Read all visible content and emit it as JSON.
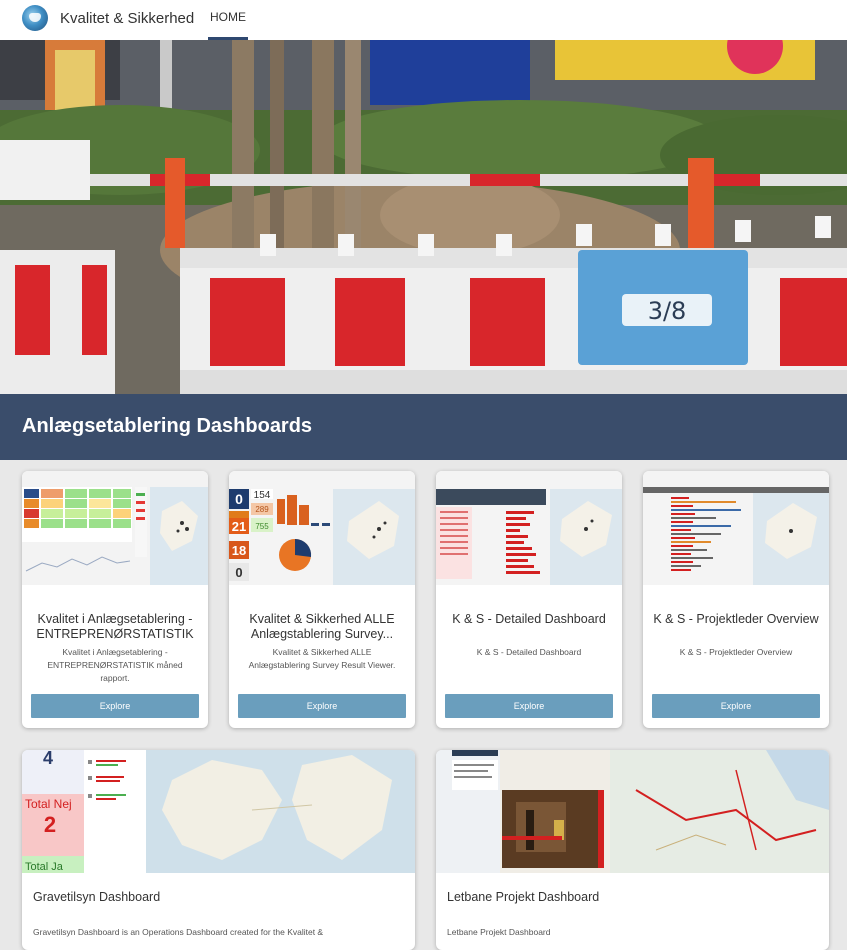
{
  "header": {
    "site_title": "Kvalitet & Sikkerhed",
    "nav_home": "HOME"
  },
  "section": {
    "title": "Anlægsetablering Dashboards"
  },
  "cards": [
    {
      "title": "Kvalitet i Anlægsetablering - ENTREPRENØRSTATISTIK",
      "description": "Kvalitet i Anlægsetablering - ENTREPRENØRSTATISTIK måned rapport.",
      "button": "Explore"
    },
    {
      "title": "Kvalitet & Sikkerhed ALLE Anlægstablering Survey...",
      "description": "Kvalitet & Sikkerhed ALLE Anlægstablering Survey Result Viewer.",
      "button": "Explore",
      "thumb_numbers": [
        "154",
        "0",
        "289",
        "21",
        "755",
        "18",
        "0"
      ]
    },
    {
      "title": "K & S - Detailed Dashboard",
      "description": "K & S - Detailed Dashboard",
      "button": "Explore"
    },
    {
      "title": "K & S - Projektleder Overview",
      "description": "K & S - Projektleder Overview",
      "button": "Explore"
    },
    {
      "title": "Gravetilsyn Dashboard",
      "description": "Gravetilsyn Dashboard is an Operations Dashboard created for the Kvalitet &",
      "thumb_text": [
        "4",
        "Total Nej",
        "2",
        "Total Ja"
      ]
    },
    {
      "title": "Letbane Projekt Dashboard",
      "description": "Letbane Projekt Dashboard"
    }
  ],
  "hero_sign_text": "3/8",
  "colors": {
    "banner": "#3a4d6b",
    "explore_button": "#6a9ebd",
    "barrier_red": "#d8262b"
  }
}
